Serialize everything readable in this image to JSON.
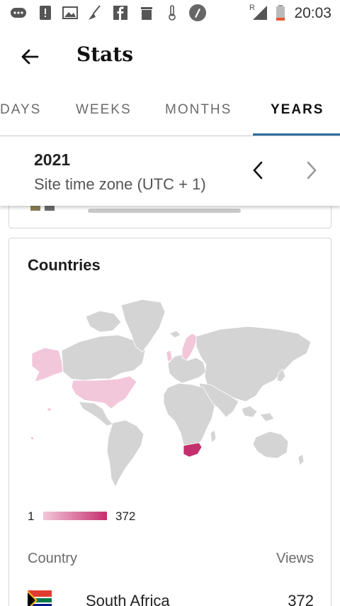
{
  "status_bar": {
    "time": "20:03",
    "signal_label": "R",
    "icons": [
      "messenger-icon",
      "alert-icon",
      "image-icon",
      "broom-icon",
      "facebook-icon",
      "trash-icon",
      "thermometer-icon",
      "compass-icon",
      "signal-icon",
      "battery-icon"
    ]
  },
  "toolbar": {
    "title": "Stats",
    "back_icon": "arrow-left-icon"
  },
  "tabs": [
    {
      "label": "DAYS"
    },
    {
      "label": "WEEKS"
    },
    {
      "label": "MONTHS"
    },
    {
      "label": "YEARS",
      "active": true
    }
  ],
  "date_selector": {
    "year": "2021",
    "timezone": "Site time zone (UTC + 1)"
  },
  "countries": {
    "title": "Countries",
    "legend_min": "1",
    "legend_max": "372",
    "column_country": "Country",
    "column_views": "Views",
    "rows": [
      {
        "country": "South Africa",
        "views": "372"
      }
    ]
  },
  "colors": {
    "accent": "#2f6f9f",
    "map_land": "#d4d4d4",
    "map_low": "#f2c7d9",
    "map_high": "#c42f6e"
  }
}
